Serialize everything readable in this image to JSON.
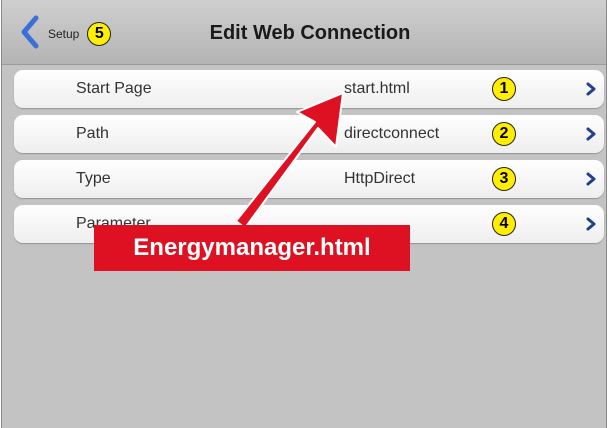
{
  "header": {
    "back_label": "Setup",
    "back_badge": "5",
    "title": "Edit Web Connection"
  },
  "rows": [
    {
      "label": "Start Page",
      "value": "start.html",
      "badge": "1"
    },
    {
      "label": "Path",
      "value": "directconnect",
      "badge": "2"
    },
    {
      "label": "Type",
      "value": "HttpDirect",
      "badge": "3"
    },
    {
      "label": "Parameter",
      "value": "",
      "badge": "4"
    }
  ],
  "callout": {
    "text": "Energymanager.html"
  },
  "colors": {
    "badge_fill": "#ffee00",
    "callout": "#dd1122",
    "chevron": "#1f3f8f",
    "back_chevron": "#3a6fd8"
  }
}
